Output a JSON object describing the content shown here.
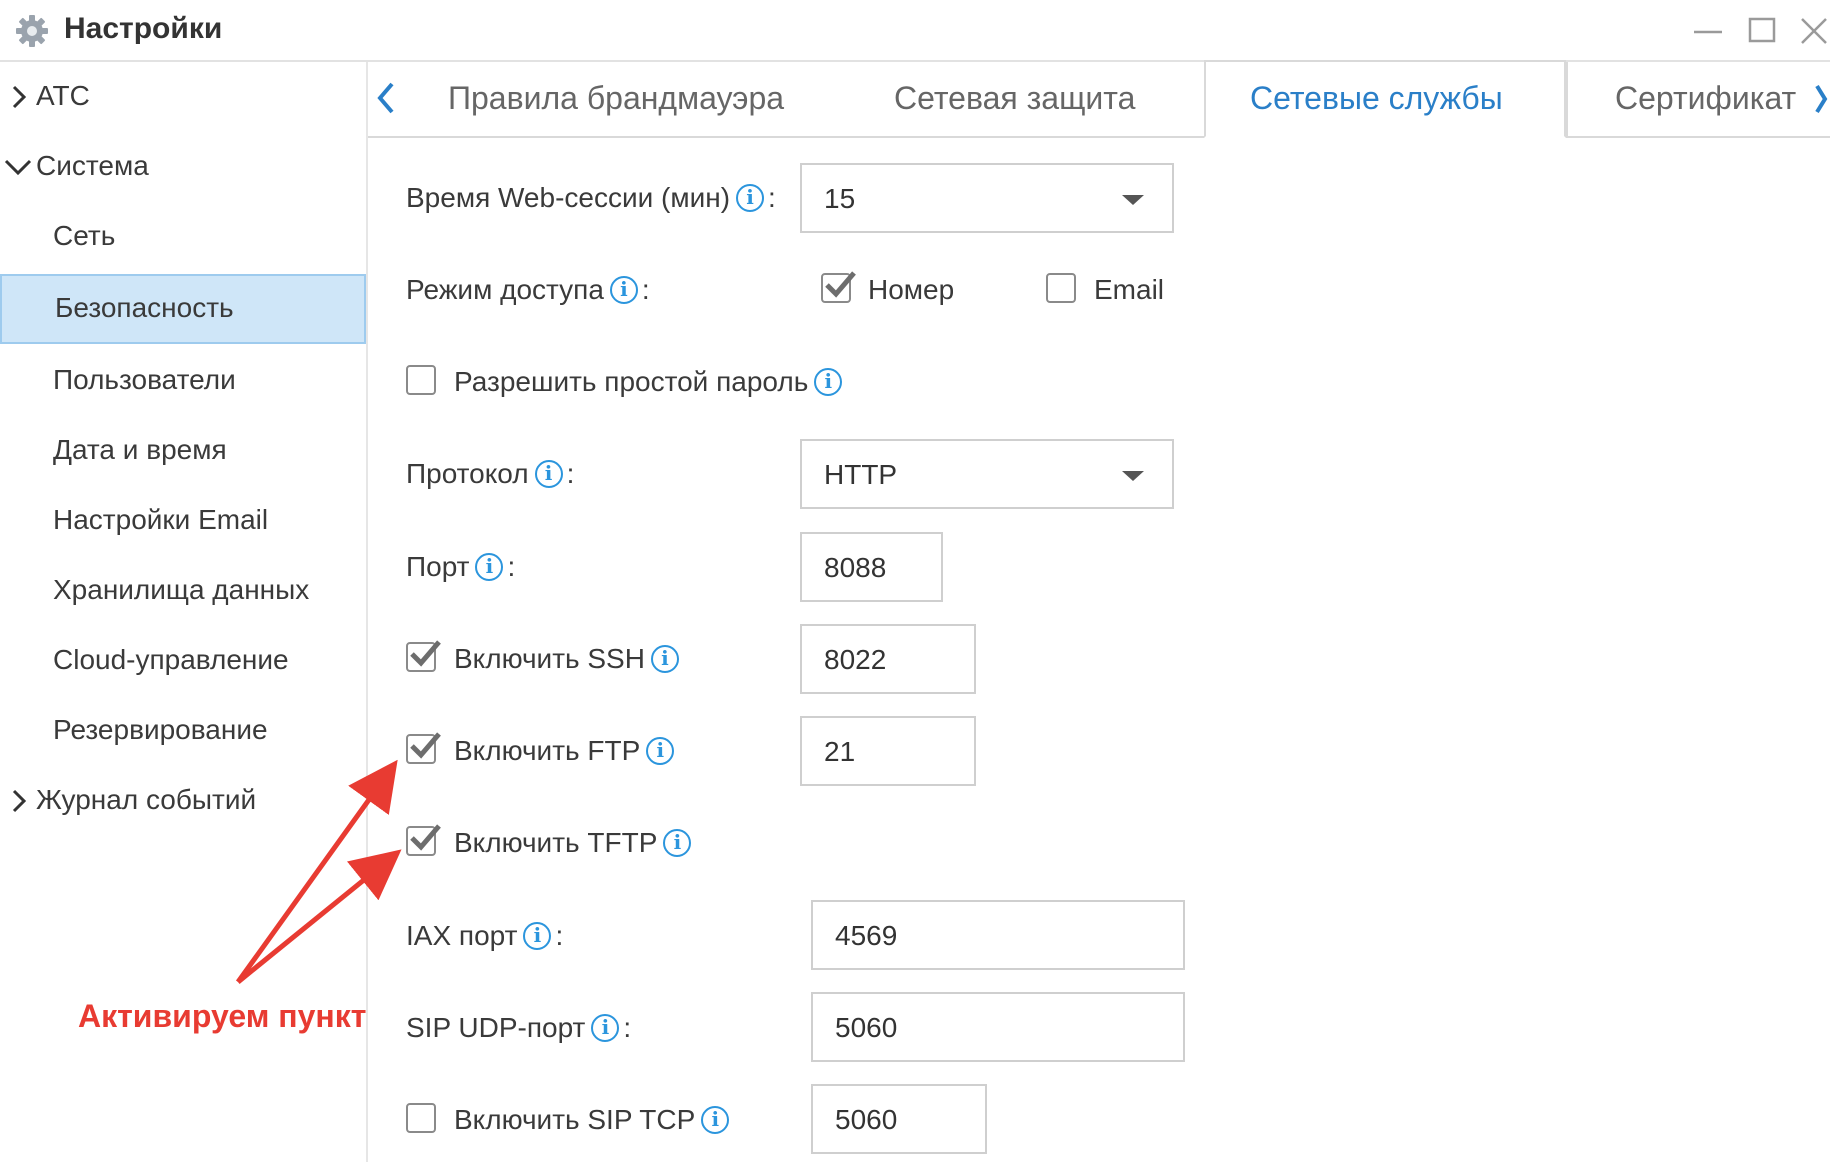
{
  "window": {
    "title": "Настройки",
    "controls": [
      "minimize",
      "maximize",
      "close"
    ]
  },
  "sidebar": {
    "items": [
      {
        "label": "АТС",
        "type": "group",
        "expanded": false
      },
      {
        "label": "Система",
        "type": "group",
        "expanded": true
      },
      {
        "label": "Сеть",
        "type": "child"
      },
      {
        "label": "Безопасность",
        "type": "child",
        "active": true
      },
      {
        "label": "Пользователи",
        "type": "child"
      },
      {
        "label": "Дата и время",
        "type": "child"
      },
      {
        "label": "Настройки Email",
        "type": "child"
      },
      {
        "label": "Хранилища данных",
        "type": "child"
      },
      {
        "label": "Cloud-управление",
        "type": "child"
      },
      {
        "label": "Резервирование",
        "type": "child"
      },
      {
        "label": "Журнал событий",
        "type": "group",
        "expanded": false
      }
    ]
  },
  "tabs": {
    "items": [
      "Правила брандмауэра",
      "Сетевая защита",
      "Сетевые службы",
      "Сертификат"
    ],
    "active_index": 2
  },
  "form": {
    "web_session": {
      "label": "Время Web-сессии (мин)",
      "value": "15"
    },
    "access_mode": {
      "label": "Режим доступа",
      "options": [
        {
          "label": "Номер",
          "checked": true
        },
        {
          "label": "Email",
          "checked": false
        }
      ]
    },
    "simple_password": {
      "label": "Разрешить простой пароль",
      "checked": false
    },
    "protocol": {
      "label": "Протокол",
      "value": "HTTP"
    },
    "port": {
      "label": "Порт",
      "value": "8088"
    },
    "ssh": {
      "label": "Включить SSH",
      "checked": true,
      "value": "8022"
    },
    "ftp": {
      "label": "Включить FTP",
      "checked": true,
      "value": "21"
    },
    "tftp": {
      "label": "Включить TFTP",
      "checked": true
    },
    "iax_port": {
      "label": "IAX порт",
      "value": "4569"
    },
    "sip_udp": {
      "label": "SIP UDP-порт",
      "value": "5060"
    },
    "sip_tcp": {
      "label": "Включить SIP TCP",
      "checked": false,
      "value": "5060"
    }
  },
  "annotation": {
    "text": "Активируем пункт",
    "color": "#e83b32"
  },
  "colors": {
    "accent": "#2a7fc8",
    "info": "#2b95dd",
    "active_row": "#cfe6f8"
  }
}
